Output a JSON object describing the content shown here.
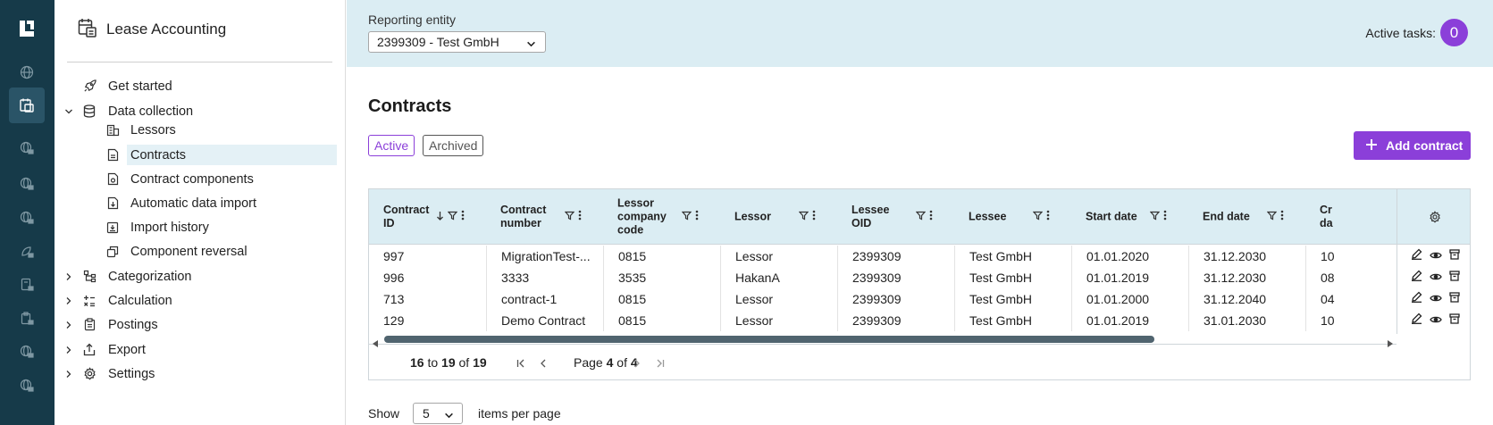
{
  "app": {
    "title": "Lease Accounting"
  },
  "nav": {
    "items": [
      {
        "label": "Get started",
        "icon": "rocket-icon",
        "expandable": false
      },
      {
        "label": "Data collection",
        "icon": "database-icon",
        "expandable": true,
        "expanded": true
      },
      {
        "label": "Categorization",
        "icon": "hierarchy-icon",
        "expandable": true
      },
      {
        "label": "Calculation",
        "icon": "calculator-icon",
        "expandable": true
      },
      {
        "label": "Postings",
        "icon": "clipboard-icon",
        "expandable": true
      },
      {
        "label": "Export",
        "icon": "upload-icon",
        "expandable": true
      },
      {
        "label": "Settings",
        "icon": "gear-icon",
        "expandable": true
      }
    ],
    "sub_items": [
      {
        "label": "Lessors",
        "icon": "building-icon"
      },
      {
        "label": "Contracts",
        "icon": "document-icon",
        "selected": true
      },
      {
        "label": "Contract components",
        "icon": "components-icon"
      },
      {
        "label": "Automatic data import",
        "icon": "file-import-icon"
      },
      {
        "label": "Import history",
        "icon": "history-icon"
      },
      {
        "label": "Component reversal",
        "icon": "reversal-icon"
      }
    ]
  },
  "topbar": {
    "entity_label": "Reporting entity",
    "entity_value": "2399309 - Test GmbH",
    "tasks_label": "Active tasks:",
    "tasks_count": "0"
  },
  "page": {
    "title": "Contracts",
    "filters": {
      "active": "Active",
      "archived": "Archived"
    },
    "add_button": "Add contract"
  },
  "table": {
    "columns": [
      "Contract\nID",
      "Contract\nnumber",
      "Lessor\ncompany\ncode",
      "Lessor",
      "Lessee\nOID",
      "Lessee",
      "Start date",
      "End date",
      "Cr\nda"
    ],
    "rows": [
      [
        "997",
        "MigrationTest-...",
        "0815",
        "Lessor",
        "2399309",
        "Test GmbH",
        "01.01.2020",
        "31.12.2030",
        "10"
      ],
      [
        "996",
        "3333",
        "3535",
        "HakanA",
        "2399309",
        "Test GmbH",
        "01.01.2019",
        "31.12.2030",
        "08"
      ],
      [
        "713",
        "contract-1",
        "0815",
        "Lessor",
        "2399309",
        "Test GmbH",
        "01.01.2000",
        "31.12.2040",
        "04"
      ],
      [
        "129",
        "Demo Contract",
        "0815",
        "Lessor",
        "2399309",
        "Test GmbH",
        "01.01.2019",
        "31.01.2030",
        "10"
      ]
    ]
  },
  "pager": {
    "from": "16",
    "to_word": "to",
    "to": "19",
    "of_word": "of",
    "total": "19",
    "page_word": "Page",
    "page": "4",
    "page_of": "of",
    "pages": "4"
  },
  "footer": {
    "show": "Show",
    "per_page": "5",
    "items_per_page": "items per page"
  },
  "colors": {
    "accent": "#8b3fd9",
    "rail": "#163a49",
    "header_bg": "#dbedf3"
  }
}
